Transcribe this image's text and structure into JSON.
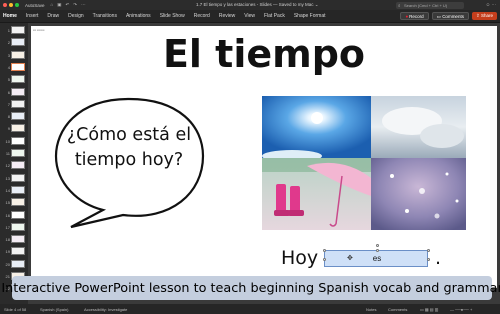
{
  "titlebar": {
    "autosave": "AutoSave",
    "doc_title": "1.7 El tiempo y las estaciones - Slides — Saved to my Mac ⌄",
    "search_placeholder": "Search (Cmd + Ctrl + U)"
  },
  "ribbon": {
    "tabs": [
      "Home",
      "Insert",
      "Draw",
      "Design",
      "Transitions",
      "Animations",
      "Slide Show",
      "Record",
      "Review",
      "View",
      "Flat Pack",
      "Shape Format"
    ],
    "record_label": "Record",
    "comments_label": "Comments",
    "share_label": "Share"
  },
  "rail": {
    "slide_numbers": [
      "1",
      "2",
      "3",
      "4",
      "5",
      "6",
      "7",
      "8",
      "9",
      "10",
      "11",
      "12",
      "13",
      "14",
      "15",
      "16",
      "17",
      "18",
      "19",
      "20",
      "21",
      "22"
    ]
  },
  "slide": {
    "title": "El tiempo",
    "bubble_text": "¿Cómo está el tiempo hoy?",
    "hoy_label": "Hoy",
    "answer": "es",
    "period": "."
  },
  "banner": {
    "caption": "Interactive PowerPoint lesson to teach beginning Spanish vocab and grammar"
  },
  "status": {
    "slide_info": "Slide 4 of 58",
    "language": "Spanish (Spain)",
    "accessibility": "Accessibility: Investigate",
    "notes": "Notes",
    "comments": "Comments"
  },
  "colors": {
    "share_orange": "#c43e1c",
    "answer_fill": "#cfe0f7",
    "banner_fill": "#c4cede"
  }
}
